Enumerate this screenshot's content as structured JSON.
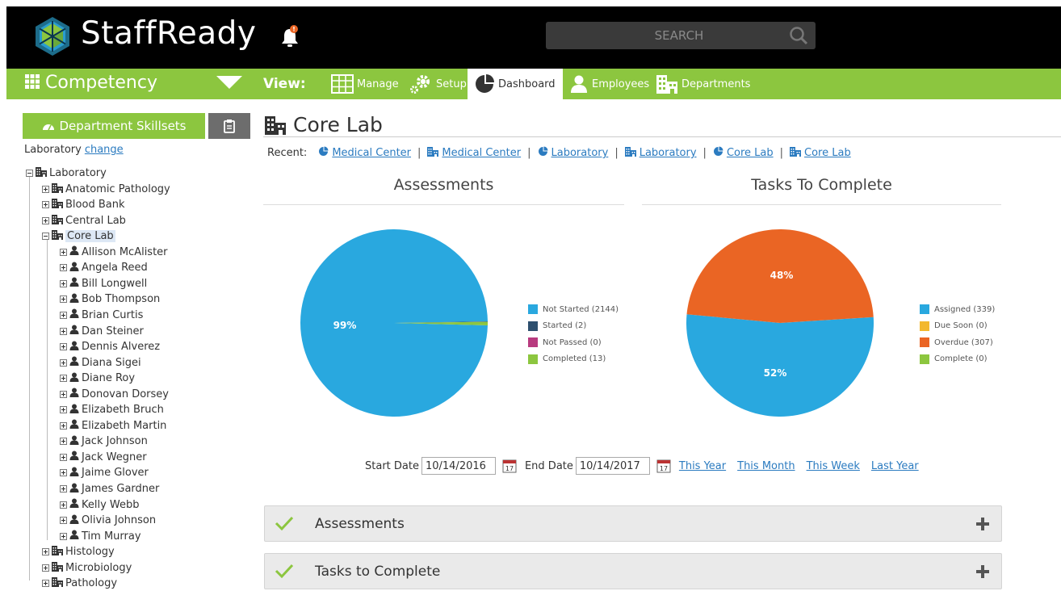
{
  "header": {
    "brand": "StaffReady",
    "search_placeholder": "SEARCH"
  },
  "navbar": {
    "module": "Competency",
    "view_label": "View:",
    "items": [
      {
        "label": "Manage",
        "icon": "grid-icon"
      },
      {
        "label": "Setup",
        "icon": "gears-icon"
      },
      {
        "label": "Dashboard",
        "icon": "pie-chart-icon",
        "active": true
      },
      {
        "label": "Employees",
        "icon": "user-icon"
      },
      {
        "label": "Departments",
        "icon": "building-icon"
      }
    ]
  },
  "sidebar": {
    "skillsets_button": "Department Skillsets",
    "location": "Laboratory",
    "change_link": "change",
    "tree": [
      {
        "label": "Laboratory",
        "type": "dept",
        "expanded": true
      },
      {
        "label": "Anatomic Pathology",
        "type": "dept"
      },
      {
        "label": "Blood Bank",
        "type": "dept"
      },
      {
        "label": "Central Lab",
        "type": "dept"
      },
      {
        "label": "Core Lab",
        "type": "dept",
        "expanded": true,
        "selected": true
      },
      {
        "label": "Allison McAlister",
        "type": "person"
      },
      {
        "label": "Angela Reed",
        "type": "person"
      },
      {
        "label": "Bill Longwell",
        "type": "person"
      },
      {
        "label": "Bob Thompson",
        "type": "person"
      },
      {
        "label": "Brian Curtis",
        "type": "person"
      },
      {
        "label": "Dan Steiner",
        "type": "person"
      },
      {
        "label": "Dennis Alverez",
        "type": "person"
      },
      {
        "label": "Diana Sigei",
        "type": "person"
      },
      {
        "label": "Diane Roy",
        "type": "person"
      },
      {
        "label": "Donovan Dorsey",
        "type": "person"
      },
      {
        "label": "Elizabeth Bruch",
        "type": "person"
      },
      {
        "label": "Elizabeth Martin",
        "type": "person"
      },
      {
        "label": "Jack Johnson",
        "type": "person"
      },
      {
        "label": "Jack Wegner",
        "type": "person"
      },
      {
        "label": "Jaime Glover",
        "type": "person"
      },
      {
        "label": "James Gardner",
        "type": "person"
      },
      {
        "label": "Kelly Webb",
        "type": "person"
      },
      {
        "label": "Olivia Johnson",
        "type": "person"
      },
      {
        "label": "Tim Murray",
        "type": "person"
      },
      {
        "label": "Histology",
        "type": "dept"
      },
      {
        "label": "Microbiology",
        "type": "dept"
      },
      {
        "label": "Pathology",
        "type": "dept"
      }
    ]
  },
  "main": {
    "title": "Core Lab",
    "recent_label": "Recent:",
    "recent": [
      {
        "label": "Medical Center",
        "icon": "pie-chart-icon"
      },
      {
        "label": "Medical Center",
        "icon": "building-icon"
      },
      {
        "label": "Laboratory",
        "icon": "pie-chart-icon"
      },
      {
        "label": "Laboratory",
        "icon": "building-icon"
      },
      {
        "label": "Core Lab",
        "icon": "pie-chart-icon"
      },
      {
        "label": "Core Lab",
        "icon": "building-icon"
      }
    ],
    "dates": {
      "start_label": "Start Date",
      "start_value": "10/14/2016",
      "end_label": "End Date",
      "end_value": "10/14/2017",
      "links": [
        "This Year",
        "This Month",
        "This Week",
        "Last Year"
      ]
    },
    "accordions": [
      {
        "title": "Assessments"
      },
      {
        "title": "Tasks to Complete"
      }
    ]
  },
  "chart_data": [
    {
      "type": "pie",
      "title": "Assessments",
      "categories": [
        "Not Started (2144)",
        "Started (2)",
        "Not Passed (0)",
        "Completed (13)"
      ],
      "values": [
        2144,
        2,
        0,
        13
      ],
      "colors": [
        "#29a8df",
        "#2d4f6e",
        "#b83b7f",
        "#8cc63f"
      ],
      "data_labels": [
        "99%"
      ],
      "legend": "right"
    },
    {
      "type": "pie",
      "title": "Tasks To Complete",
      "categories": [
        "Assigned (339)",
        "Due Soon (0)",
        "Overdue (307)",
        "Complete (0)"
      ],
      "values": [
        339,
        0,
        307,
        0
      ],
      "colors": [
        "#29a8df",
        "#f3b82e",
        "#ea6524",
        "#8cc63f"
      ],
      "data_labels": [
        "52%",
        "48%"
      ],
      "legend": "right"
    }
  ]
}
